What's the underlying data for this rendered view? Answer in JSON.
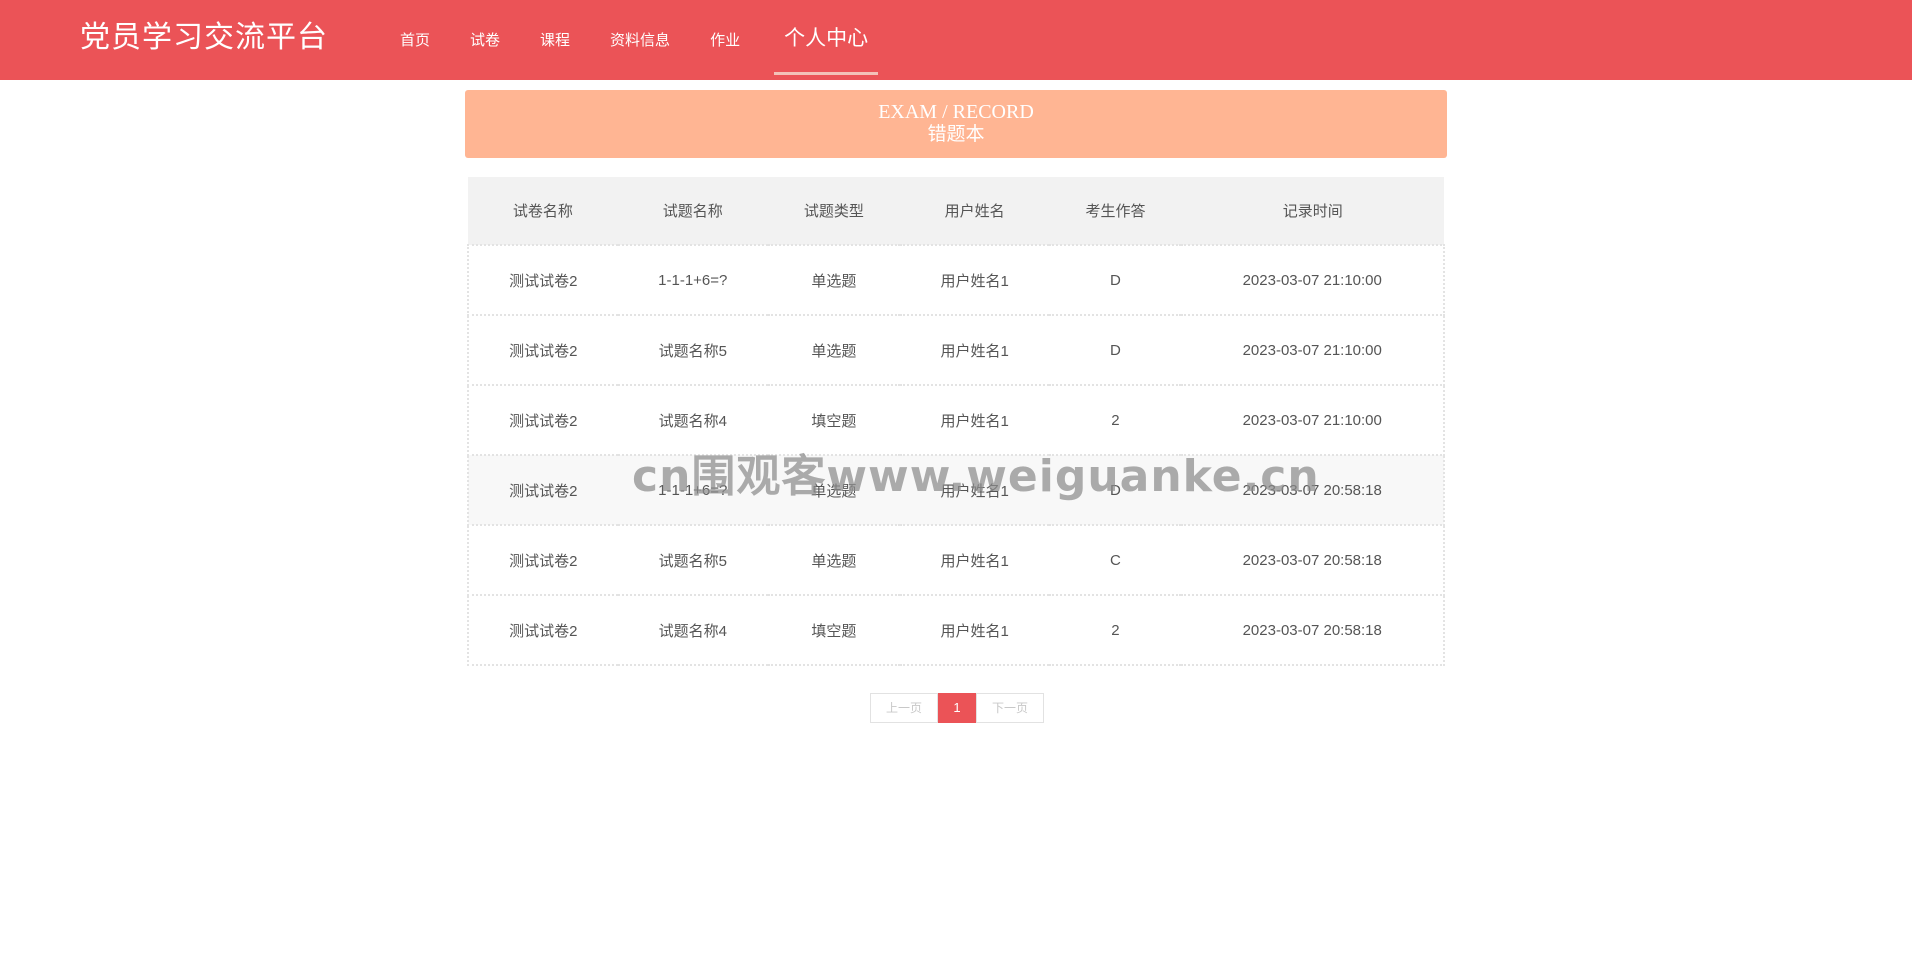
{
  "app": {
    "title": "党员学习交流平台"
  },
  "nav": {
    "items": [
      {
        "label": "首页"
      },
      {
        "label": "试卷"
      },
      {
        "label": "课程"
      },
      {
        "label": "资料信息"
      },
      {
        "label": "作业"
      },
      {
        "label": "个人中心",
        "active": true
      }
    ]
  },
  "banner": {
    "en": "EXAM / RECORD",
    "cn": "错题本"
  },
  "table": {
    "headers": [
      "试卷名称",
      "试题名称",
      "试题类型",
      "用户姓名",
      "考生作答",
      "记录时间"
    ],
    "rows": [
      [
        "测试试卷2",
        "1-1-1+6=?",
        "单选题",
        "用户姓名1",
        "D",
        "2023-03-07 21:10:00"
      ],
      [
        "测试试卷2",
        "试题名称5",
        "单选题",
        "用户姓名1",
        "D",
        "2023-03-07 21:10:00"
      ],
      [
        "测试试卷2",
        "试题名称4",
        "填空题",
        "用户姓名1",
        "2",
        "2023-03-07 21:10:00"
      ],
      [
        "测试试卷2",
        "1-1-1+6=?",
        "单选题",
        "用户姓名1",
        "D",
        "2023-03-07 20:58:18"
      ],
      [
        "测试试卷2",
        "试题名称5",
        "单选题",
        "用户姓名1",
        "C",
        "2023-03-07 20:58:18"
      ],
      [
        "测试试卷2",
        "试题名称4",
        "填空题",
        "用户姓名1",
        "2",
        "2023-03-07 20:58:18"
      ]
    ]
  },
  "pagination": {
    "prev": "上一页",
    "current": "1",
    "next": "下一页"
  },
  "watermark": "cn围观客www.weiguanke.cn",
  "colors": {
    "primary": "#eb5357",
    "banner": "#ffb593"
  }
}
